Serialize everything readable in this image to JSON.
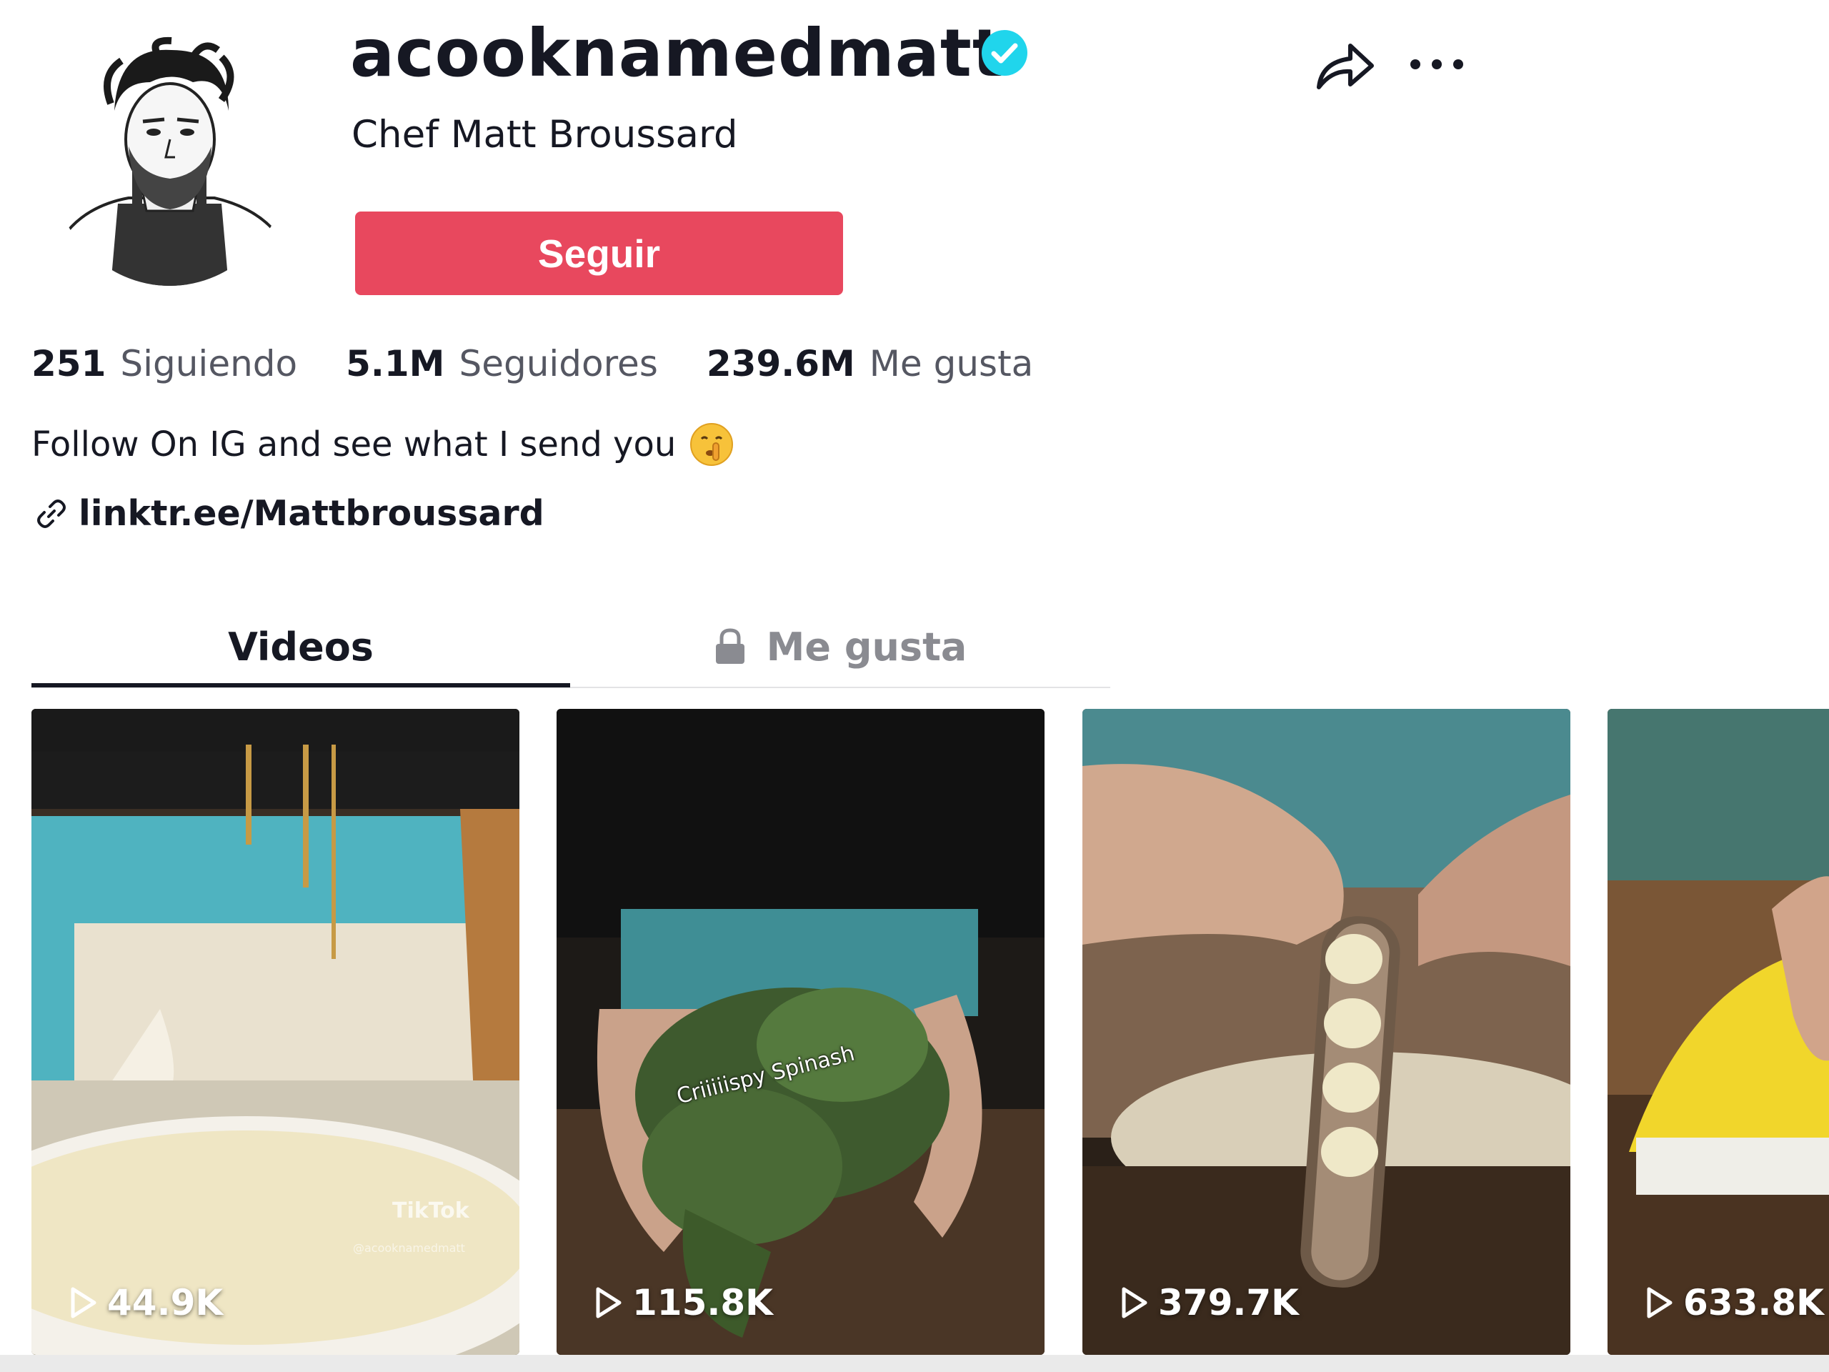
{
  "profile": {
    "username": "acooknamedmatt",
    "display_name": "Chef Matt Broussard",
    "follow_label": "Seguir",
    "stats": [
      {
        "number": "251",
        "label": "Siguiendo"
      },
      {
        "number": "5.1M",
        "label": "Seguidores"
      },
      {
        "number": "239.6M",
        "label": "Me gusta"
      }
    ],
    "bio": "Follow On IG and see what I send you",
    "link": "linktr.ee/Mattbroussard"
  },
  "tabs": {
    "videos": "Videos",
    "likes": "Me gusta"
  },
  "videos": [
    {
      "views": "44.9K",
      "watermark": "TikTok",
      "watermark_handle": "@acooknamedmatt"
    },
    {
      "views": "115.8K",
      "caption": "Criiiiispy Spinash"
    },
    {
      "views": "379.7K"
    },
    {
      "views": "633.8K"
    }
  ],
  "icons": {
    "verified": "verified-badge-icon",
    "share": "share-arrow-icon",
    "more": "more-dots-icon",
    "link": "chain-link-icon",
    "lock": "lock-icon",
    "play": "play-outline-icon",
    "emoji": "shushing-face-emoji"
  },
  "colors": {
    "follow_button": "#e8485e",
    "verified": "#20d5ec"
  }
}
